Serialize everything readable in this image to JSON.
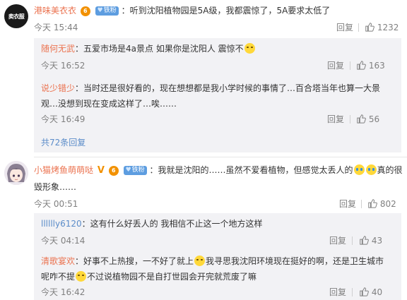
{
  "comments": [
    {
      "avatar_text": "卖衣服",
      "user": "港味美衣衣",
      "vip_text": "6",
      "fan_label": "铁粉",
      "text": "：听到沈阳植物园是5A级，我都震惊了，5A要求太低了",
      "time": "今天 15:44",
      "reply_label": "回复",
      "likes": "1232",
      "replies": [
        {
          "user": "随何无武",
          "text": "：五爱市场是4a景点 如果你是沈阳人 震惊不",
          "time": "今天 16:52",
          "reply_label": "回复",
          "likes": "163"
        },
        {
          "user": "说少错少",
          "text_line1": "：当时还是很好看的，现在想想都是我小学时候的事情了…百合塔当年也算一大景",
          "text_line2": "观…没想到现在变成这样了…唉……",
          "time": "今天 16:49",
          "reply_label": "回复",
          "likes": "56"
        }
      ],
      "more_text": "共72条回复"
    },
    {
      "user": "小猫烤鱼萌萌哒",
      "vip_text": "6",
      "fan_label": "铁粉",
      "text_line1_a": "：我就是沈阳的……虽然不爱看植物，但感觉太丢人的",
      "text_line1_b": "真的很",
      "text_line2": "毁形象……",
      "time": "今天 00:51",
      "reply_label": "回复",
      "likes": "802",
      "replies": [
        {
          "user": "lllllly6120",
          "text": "：这有什么好丢人的 我相信不止这一个地方这样",
          "time": "今天 04:14",
          "reply_label": "回复",
          "likes": "43"
        },
        {
          "user": "清歌宴欢",
          "text_line1_a": "：好事不上热搜，一不好了就上",
          "text_line1_b": "我寻思我沈阳环境现在挺好的啊，还是卫生城市",
          "text_line2_a": "呢咋不提",
          "text_line2_b": "不过说植物园不是自打世园会开完就荒废了嘛",
          "time": "今天 16:42",
          "reply_label": "回复",
          "likes": "40"
        }
      ]
    }
  ],
  "colors": {
    "username": "#eb7350",
    "link": "#5b8cc9",
    "reply_bg": "#f2f2f5",
    "muted": "#808080"
  },
  "icons": {
    "like": "thumbs-up-icon",
    "emoji_smile": "smile-emoji",
    "emoji_cry": "cry-laugh-emoji"
  }
}
